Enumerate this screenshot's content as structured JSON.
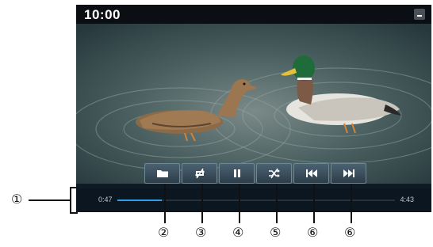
{
  "status_bar": {
    "time": "10:00",
    "menu_icon": "menu-icon"
  },
  "player": {
    "elapsed": "0:47",
    "duration": "4:43",
    "progress_fraction": 0.16,
    "accent_color": "#2f9fe8",
    "controls": [
      {
        "name": "folder-button",
        "icon": "folder-icon"
      },
      {
        "name": "repeat-off-button",
        "icon": "repeat-off-icon"
      },
      {
        "name": "pause-button",
        "icon": "pause-icon"
      },
      {
        "name": "shuffle-off-button",
        "icon": "shuffle-off-icon"
      },
      {
        "name": "previous-track-button",
        "icon": "skip-back-icon"
      },
      {
        "name": "next-track-button",
        "icon": "skip-forward-icon"
      }
    ]
  },
  "callouts": {
    "c1": "①",
    "c2": "②",
    "c3": "③",
    "c4": "④",
    "c5": "⑤",
    "c6a": "⑥",
    "c6b": "⑥"
  }
}
